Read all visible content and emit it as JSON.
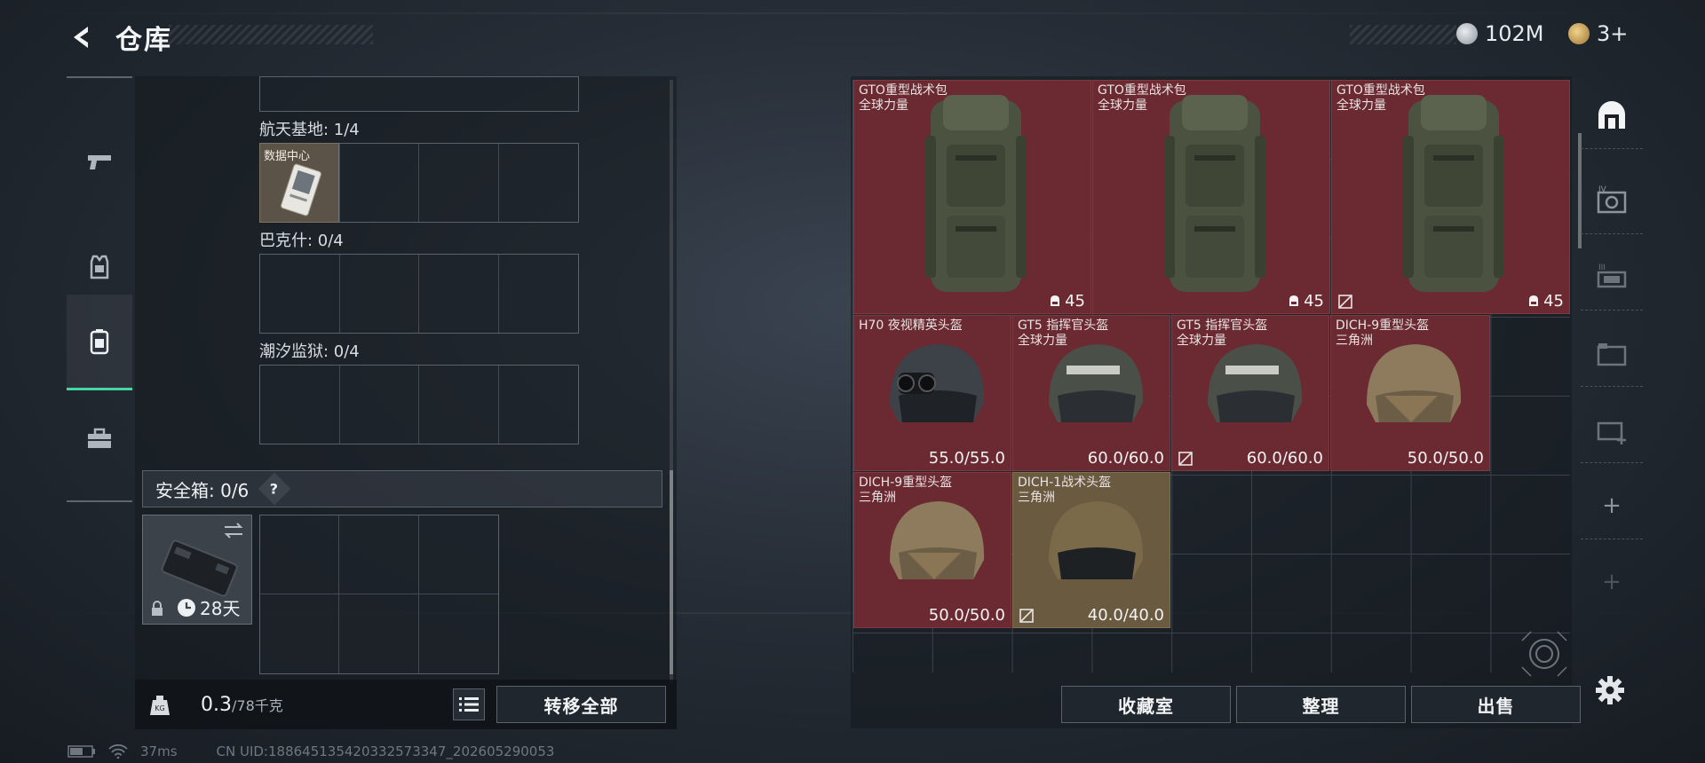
{
  "header": {
    "title": "仓库",
    "currencies": [
      {
        "icon": "silver-coin-icon",
        "value": "102M"
      },
      {
        "icon": "gold-coin-icon",
        "value": "3+"
      }
    ]
  },
  "left_tabs": [
    {
      "icon": "pistol-icon"
    },
    {
      "icon": "armor-vest-icon"
    },
    {
      "icon": "backpack-icon",
      "active": true
    },
    {
      "icon": "toolbox-icon"
    }
  ],
  "storage": {
    "sections": [
      {
        "label": "航天基地: 1/4",
        "item_label": "数据中心"
      },
      {
        "label": "巴克什: 0/4"
      },
      {
        "label": "潮汐监狱: 0/4"
      }
    ],
    "safebox": {
      "label": "安全箱: 0/6",
      "help": "?",
      "timer": "28天"
    },
    "weight": {
      "value": "0.3",
      "unit": "/78千克"
    },
    "transfer_all": "转移全部"
  },
  "inventory": {
    "items": [
      {
        "name": "GTO重型战术包",
        "sub": "全球力量",
        "value": "45",
        "kind": "backpack"
      },
      {
        "name": "GTO重型战术包",
        "sub": "全球力量",
        "value": "45",
        "kind": "backpack"
      },
      {
        "name": "GTO重型战术包",
        "sub": "全球力量",
        "value": "45",
        "kind": "backpack",
        "flag": true
      },
      {
        "name": "H70 夜视精英头盔",
        "sub": "",
        "value": "55.0/55.0",
        "kind": "helmet-nv"
      },
      {
        "name": "GT5 指挥官头盔",
        "sub": "全球力量",
        "value": "60.0/60.0",
        "kind": "helmet-gt5"
      },
      {
        "name": "GT5 指挥官头盔",
        "sub": "全球力量",
        "value": "60.0/60.0",
        "kind": "helmet-gt5",
        "flag": true
      },
      {
        "name": "DICH-9重型头盔",
        "sub": "三角洲",
        "value": "50.0/50.0",
        "kind": "helmet-dich"
      },
      {
        "name": "DICH-9重型头盔",
        "sub": "三角洲",
        "value": "50.0/50.0",
        "kind": "helmet-dich"
      },
      {
        "name": "DICH-1战术头盔",
        "sub": "三角洲",
        "value": "40.0/40.0",
        "kind": "helmet-dich1",
        "flag": true
      }
    ],
    "buttons": {
      "collection": "收藏室",
      "sort": "整理",
      "sell": "出售"
    }
  },
  "right_tabs": [
    {
      "icon": "stash-home-icon"
    },
    {
      "icon": "stash-iv-icon"
    },
    {
      "icon": "stash-iii-icon"
    },
    {
      "icon": "stash-ii-icon"
    },
    {
      "icon": "stash-add-icon"
    }
  ],
  "status": {
    "ping": "37ms",
    "uid": "CN UID:18864513542033257​3347_202605290053"
  },
  "colors": {
    "accent": "#46d6a4",
    "item_red": "#6b2a31",
    "item_gold": "#6a5a3f"
  }
}
